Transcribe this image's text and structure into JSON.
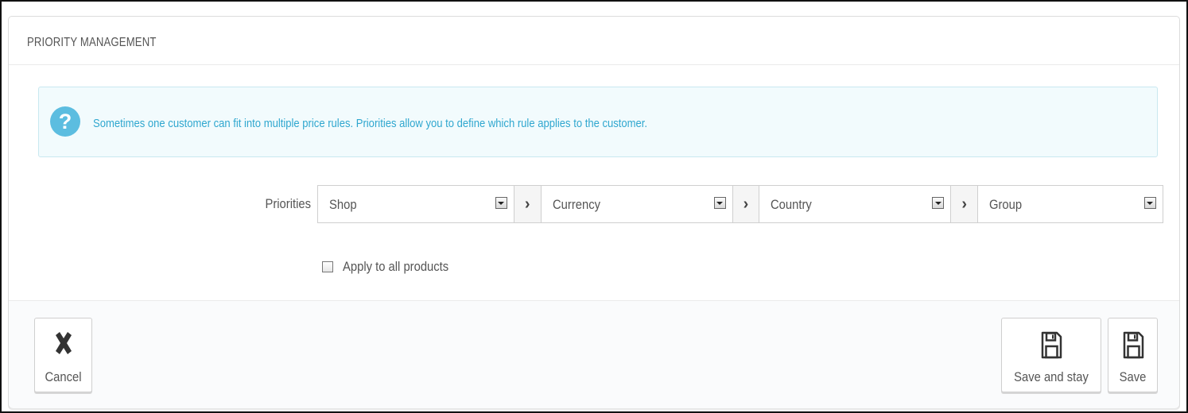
{
  "panel": {
    "title": "PRIORITY MANAGEMENT"
  },
  "alert": {
    "icon": "question-icon",
    "icon_glyph": "?",
    "text": "Sometimes one customer can fit into multiple price rules. Priorities allow you to define which rule applies to the customer.",
    "color": "#2fa7cf"
  },
  "priorities": {
    "label": "Priorities",
    "selects": [
      {
        "value": "Shop"
      },
      {
        "value": "Currency"
      },
      {
        "value": "Country"
      },
      {
        "value": "Group"
      }
    ],
    "separator_glyph": "›"
  },
  "apply_all": {
    "label": "Apply to all products",
    "checked": false
  },
  "footer": {
    "cancel_label": "Cancel",
    "save_and_stay_label": "Save and stay",
    "save_label": "Save"
  }
}
